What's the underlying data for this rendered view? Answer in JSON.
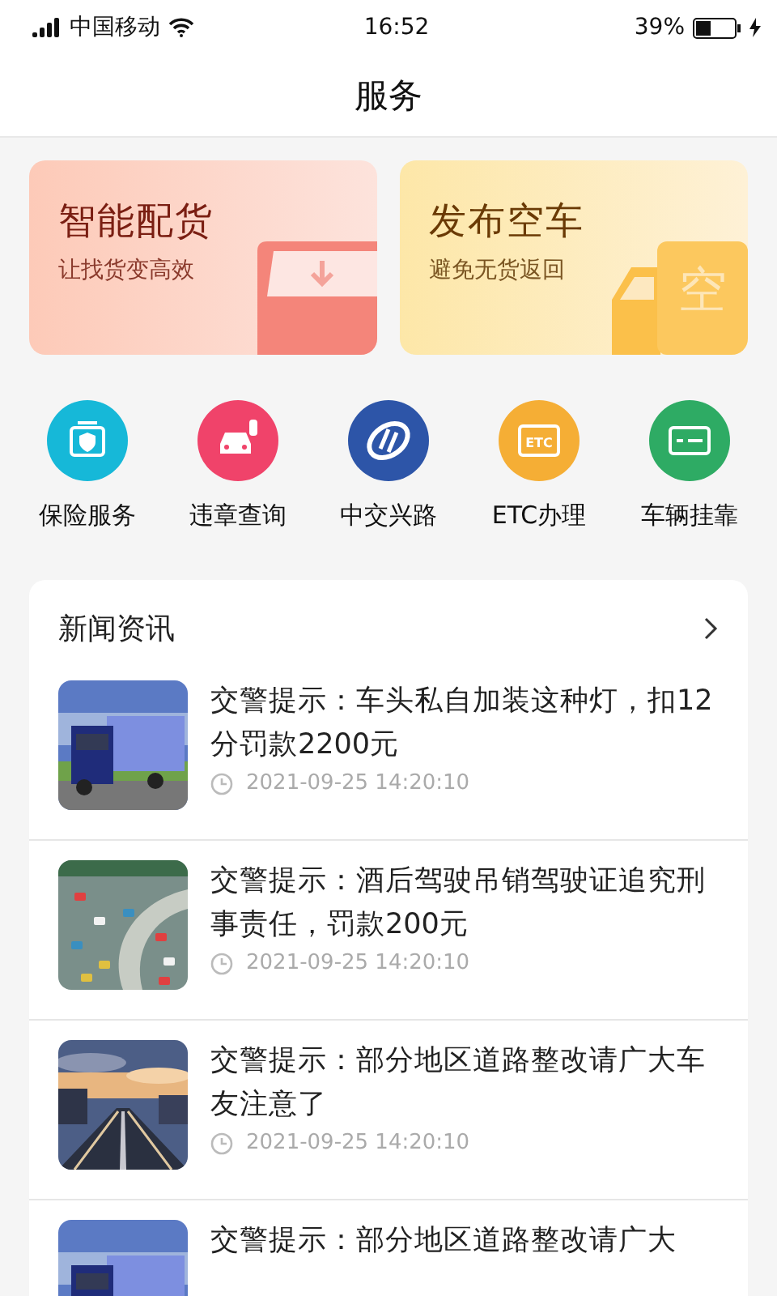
{
  "status_bar": {
    "carrier": "中国移动",
    "time": "16:52",
    "battery": "39%"
  },
  "header": {
    "title": "服务"
  },
  "promo_cards": [
    {
      "title": "智能配货",
      "subtitle": "让找货变高效"
    },
    {
      "title": "发布空车",
      "subtitle": "避免无货返回",
      "badge": "空"
    }
  ],
  "services": [
    {
      "label": "保险服务",
      "color": "#16b8d8"
    },
    {
      "label": "违章查询",
      "color": "#f0436a"
    },
    {
      "label": "中交兴路",
      "color": "#2d55a8"
    },
    {
      "label": "ETC办理",
      "color": "#f5ae35",
      "icon_text": "ETC"
    },
    {
      "label": "车辆挂靠",
      "color": "#2eab64"
    }
  ],
  "news": {
    "title": "新闻资讯",
    "items": [
      {
        "title": "交警提示：车头私自加装这种灯，扣12分罚款2200元",
        "time": "2021-09-25  14:20:10"
      },
      {
        "title": "交警提示：酒后驾驶吊销驾驶证追究刑事责任，罚款200元",
        "time": "2021-09-25  14:20:10"
      },
      {
        "title": "交警提示：部分地区道路整改请广大车友注意了",
        "time": "2021-09-25  14:20:10"
      },
      {
        "title": "交警提示：部分地区道路整改请广大"
      }
    ]
  }
}
